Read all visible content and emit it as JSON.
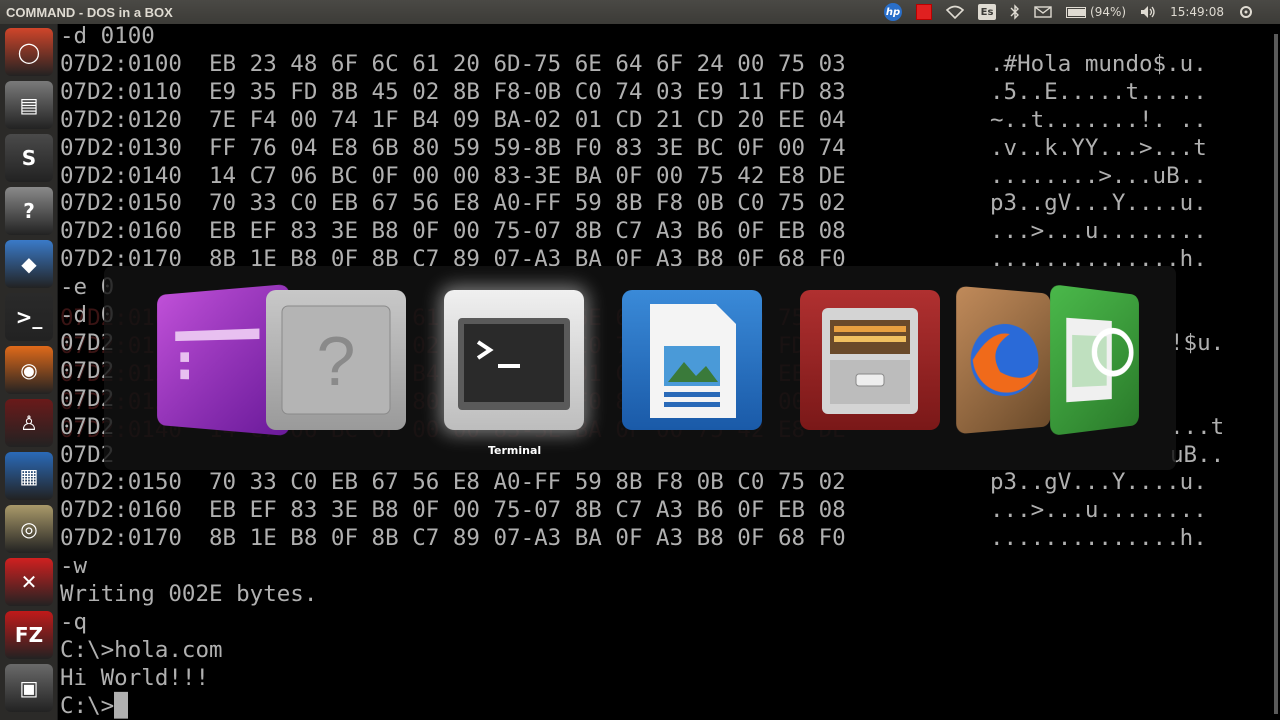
{
  "top_panel": {
    "title": "COMMAND - DOS in a BOX",
    "indicators": {
      "hp": "hp",
      "keyboard": "Es",
      "battery_text": "(94%)",
      "battery_level": 0.94,
      "clock": "15:49:08",
      "icons": [
        "hp-icon",
        "red-app-icon",
        "network-icon",
        "keyboard-layout-icon",
        "bluetooth-icon",
        "mail-icon",
        "battery-icon",
        "volume-icon",
        "power-gear-icon"
      ]
    }
  },
  "launcher": {
    "items": [
      {
        "name": "ubuntu-logo-icon",
        "glyph": "◯",
        "bg": "#d0452a"
      },
      {
        "name": "files-icon",
        "glyph": "▤",
        "bg": "#7a7a7a"
      },
      {
        "name": "sublime-text-icon",
        "glyph": "S",
        "bg": "#4a4a4a"
      },
      {
        "name": "help-icon",
        "glyph": "?",
        "bg": "#8a8a8a"
      },
      {
        "name": "virtualbox-icon",
        "glyph": "◆",
        "bg": "#3a7ac8"
      },
      {
        "name": "terminal-icon",
        "glyph": ">_",
        "bg": "#2a2a2a"
      },
      {
        "name": "firefox-icon",
        "glyph": "◉",
        "bg": "#e06a1a"
      },
      {
        "name": "wine-icon",
        "glyph": "♙",
        "bg": "#6a1a1a"
      },
      {
        "name": "libreoffice-writer-icon",
        "glyph": "▦",
        "bg": "#2a6ab8"
      },
      {
        "name": "image-viewer-icon",
        "glyph": "◎",
        "bg": "#aa9a6a"
      },
      {
        "name": "xmind-icon",
        "glyph": "✕",
        "bg": "#d02020"
      },
      {
        "name": "filezilla-icon",
        "glyph": "FZ",
        "bg": "#c01a1a"
      },
      {
        "name": "system-icon",
        "glyph": "▣",
        "bg": "#6a6a6a"
      }
    ]
  },
  "terminal": {
    "lines": [
      "-d 0100",
      "07D2:0100  EB 23 48 6F 6C 61 20 6D-75 6E 64 6F 24 00 75 03",
      "07D2:0110  E9 35 FD 8B 45 02 8B F8-0B C0 74 03 E9 11 FD 83",
      "07D2:0120  7E F4 00 74 1F B4 09 BA-02 01 CD 21 CD 20 EE 04",
      "07D2:0130  FF 76 04 E8 6B 80 59 59-8B F0 83 3E BC 0F 00 74",
      "07D2:0140  14 C7 06 BC 0F 00 00 83-3E BA 0F 00 75 42 E8 DE",
      "07D2:0150  70 33 C0 EB 67 56 E8 A0-FF 59 8B F8 0B C0 75 02",
      "07D2:0160  EB EF 83 3E B8 0F 00 75-07 8B C7 A3 B6 0F EB 08",
      "07D2:0170  8B 1E B8 0F 8B C7 89 07-A3 BA 0F A3 B8 0F 68 F0",
      "-e 0",
      "-d 0",
      "07D2",
      "07D2",
      "07D2",
      "07D2",
      "07D2",
      "07D2:0150  70 33 C0 EB 67 56 E8 A0-FF 59 8B F8 0B C0 75 02",
      "07D2:0160  EB EF 83 3E B8 0F 00 75-07 8B C7 A3 B6 0F EB 08",
      "07D2:0170  8B 1E B8 0F 8B C7 89 07-A3 BA 0F A3 B8 0F 68 F0",
      "-w",
      "Writing 002E bytes.",
      "-q",
      "C:\\>hola.com",
      "Hi World!!!",
      "C:\\>█"
    ],
    "ascii": [
      "",
      ".#Hola mundo$.u.",
      ".5..E.....t.....",
      "~..t.......!. ..",
      ".v..k.YY...>...t",
      "........>...uB..",
      "p3..gV...Y....u.",
      "...>...u........",
      "..............h.",
      "",
      "",
      "!$u.",
      "",
      "",
      "...t",
      "uB..",
      "p3..gV...Y....u.",
      "...>...u........",
      "..............h.",
      "",
      "",
      "",
      "",
      "",
      ""
    ],
    "dim_lines": [
      "               ",
      "07D2:0100  EB 23 48 6F 6C 61 20 6D-75 6E 64 6F 24 00 75 03",
      "07D2:0110  E9 35 FD 8B 45 02 8B F8-0B C0 74 03 E9 11 FD 83",
      "07D2:0120  7E F4 00 74 1F B4 09 BA-02 01 CD 21 CD 20 EE 04",
      "07D2:0130  FF 76 04 E8 6B 80 59 59-8B F0 83 3E BC 0F 00 74",
      "07D2:0140  14 C7 06 BC 0F 00 00 83-3E BA 0F 00 75 42 E8 DE"
    ]
  },
  "switcher": {
    "selected_label": "Terminal",
    "items": [
      {
        "name": "app-switcher-item-purple-app-icon"
      },
      {
        "name": "app-switcher-item-help-icon"
      },
      {
        "name": "app-switcher-item-terminal-icon"
      },
      {
        "name": "app-switcher-item-libreoffice-writer-icon"
      },
      {
        "name": "app-switcher-item-files-icon"
      },
      {
        "name": "app-switcher-item-firefox-icon"
      },
      {
        "name": "app-switcher-item-libreoffice-calc-icon"
      }
    ]
  },
  "colors": {
    "panel": "#3c3b37",
    "terminal_text": "#b0b0b0",
    "launcher": "#2b2a28"
  }
}
